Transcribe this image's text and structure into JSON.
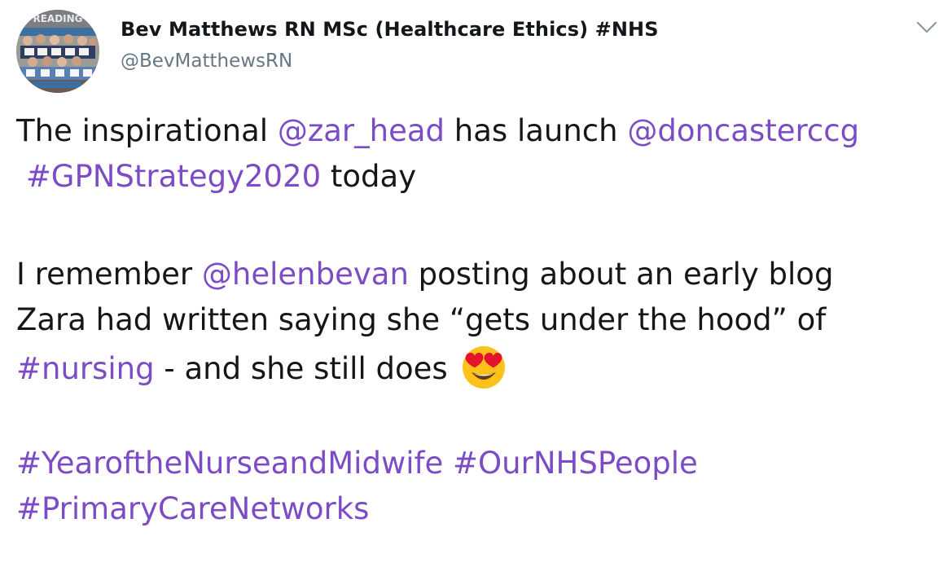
{
  "author": {
    "display_name": "Bev Matthews RN MSc (Healthcare Ethics) #NHS",
    "handle": "@BevMatthewsRN",
    "avatar_icon": "group-photo-avatar",
    "avatar_banner_text": "READING"
  },
  "menu": {
    "icon": "chevron-down-icon"
  },
  "tweet": {
    "line1": {
      "t1": "The inspirational ",
      "m1": "@zar_head",
      "t2": " has launch ",
      "m2": "@doncasterccg"
    },
    "line2": {
      "t1": " ",
      "h1": "#GPNStrategy2020",
      "t2": " today"
    },
    "line3": {
      "t1": "I remember ",
      "m1": "@helenbevan",
      "t2": " posting about an early blog"
    },
    "line4": {
      "t1": "Zara had written saying she “gets under the hood” of"
    },
    "line5": {
      "h1": "#nursing",
      "t2": " - and she still does ",
      "emoji": "heart-eyes-emoji"
    },
    "line6": {
      "h1": "#YearoftheNurseandMidwife",
      "t1": " ",
      "h2": "#OurNHSPeople"
    },
    "line7": {
      "h1": "#PrimaryCareNetworks"
    }
  },
  "colors": {
    "link": "#7c4bc6",
    "text": "#14171a",
    "secondary": "#657786",
    "emoji_face": "#fcc21b",
    "emoji_heart": "#e3142b"
  }
}
